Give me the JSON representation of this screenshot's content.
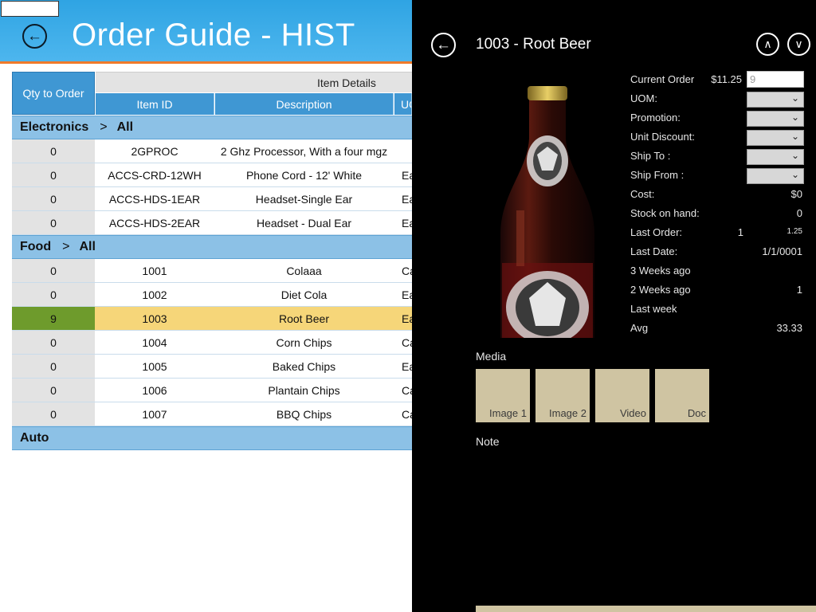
{
  "header": {
    "title": "Order Guide - HIST",
    "back_icon": "back-arrow-icon"
  },
  "grid": {
    "qty_header": "Qty to Order",
    "group_header": "Item Details",
    "columns": [
      "Item ID",
      "Description",
      "UOM"
    ],
    "groups": [
      {
        "name": "Electronics",
        "separator": ">",
        "filter": "All",
        "rows": [
          {
            "qty": "0",
            "id": "2GPROC",
            "desc": "2 Ghz Processor, With a four mgz",
            "uom": ""
          },
          {
            "qty": "0",
            "id": "ACCS-CRD-12WH",
            "desc": "Phone Cord - 12' White",
            "uom": "Ea"
          },
          {
            "qty": "0",
            "id": "ACCS-HDS-1EAR",
            "desc": "Headset-Single Ear",
            "uom": "Ea"
          },
          {
            "qty": "0",
            "id": "ACCS-HDS-2EAR",
            "desc": "Headset - Dual Ear",
            "uom": "Ea"
          }
        ]
      },
      {
        "name": "Food",
        "separator": ">",
        "filter": "All",
        "rows": [
          {
            "qty": "0",
            "id": "1001",
            "desc": "Colaaa",
            "uom": "Ca"
          },
          {
            "qty": "0",
            "id": "1002",
            "desc": "Diet Cola",
            "uom": "Ea"
          },
          {
            "qty": "9",
            "id": "1003",
            "desc": "Root Beer",
            "uom": "Ea",
            "selected": true
          },
          {
            "qty": "0",
            "id": "1004",
            "desc": "Corn Chips",
            "uom": "Ca"
          },
          {
            "qty": "0",
            "id": "1005",
            "desc": "Baked Chips",
            "uom": "Ea"
          },
          {
            "qty": "0",
            "id": "1006",
            "desc": "Plantain Chips",
            "uom": "Ca"
          },
          {
            "qty": "0",
            "id": "1007",
            "desc": "BBQ Chips",
            "uom": "Ca"
          }
        ]
      },
      {
        "name": "Auto",
        "separator": "",
        "filter": "",
        "rows": []
      }
    ]
  },
  "detail": {
    "title": "1003 - Root Beer",
    "prev_icon": "chevron-up-icon",
    "next_icon": "chevron-down-icon",
    "current_order_label": "Current Order",
    "current_order_price": "$11.25",
    "current_order_qty": "9",
    "uom_label": "UOM:",
    "promotion_label": "Promotion:",
    "unit_discount_label": "Unit Discount:",
    "ship_to_label": "Ship To :",
    "ship_from_label": "Ship From :",
    "cost_label": "Cost:",
    "cost_value": "$0",
    "stock_label": "Stock on hand:",
    "stock_value": "0",
    "last_order_label": "Last Order:",
    "last_order_qty": "1",
    "last_order_price": "1.25",
    "last_date_label": "Last Date:",
    "last_date_value": "1/1/0001",
    "weeks3_label": "3 Weeks ago",
    "weeks3_value": "",
    "weeks2_label": "2 Weeks ago",
    "weeks2_value": "1",
    "last_week_label": "Last week",
    "last_week_value": "",
    "avg_label": "Avg",
    "avg_value": "33.33",
    "media_label": "Media",
    "media_tiles": [
      "Image 1",
      "Image 2",
      "Video",
      "Doc"
    ],
    "note_label": "Note"
  },
  "colors": {
    "header_blue": "#2fa4e3",
    "header_accent": "#f07a2a",
    "column_header": "#3f97d3",
    "group_row": "#8cc1e6",
    "selected_qty": "#6e9b2c",
    "selected_row": "#f6d679",
    "flyout_bg": "#000000",
    "media_tile": "#cfc4a2"
  }
}
